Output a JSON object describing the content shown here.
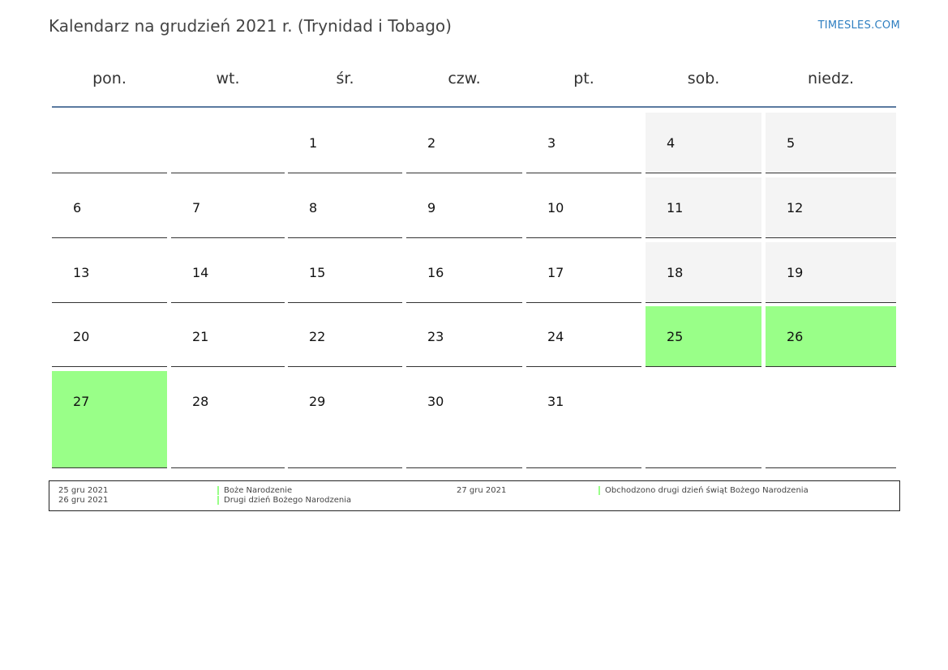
{
  "header": {
    "title": "Kalendarz na grudzień 2021 r. (Trynidad i Tobago)",
    "site": "TIMESLES.COM"
  },
  "calendar": {
    "weekdays": [
      "pon.",
      "wt.",
      "śr.",
      "czw.",
      "pt.",
      "sob.",
      "niedz."
    ],
    "weeks": [
      [
        "",
        "",
        "1",
        "2",
        "3",
        "4",
        "5"
      ],
      [
        "6",
        "7",
        "8",
        "9",
        "10",
        "11",
        "12"
      ],
      [
        "13",
        "14",
        "15",
        "16",
        "17",
        "18",
        "19"
      ],
      [
        "20",
        "21",
        "22",
        "23",
        "24",
        "25",
        "26"
      ],
      [
        "27",
        "28",
        "29",
        "30",
        "31",
        "",
        ""
      ]
    ],
    "holidays": [
      "25",
      "26",
      "27"
    ],
    "colors": {
      "holiday": "#99ff88",
      "weekend": "#f4f4f4",
      "header_rule": "#5b7aa0",
      "site_link": "#2f7fc1"
    }
  },
  "legend": {
    "items": [
      {
        "date": "25 gru 2021",
        "name": "Boże Narodzenie"
      },
      {
        "date": "26 gru 2021",
        "name": "Drugi dzień Bożego Narodzenia"
      },
      {
        "date": "27 gru 2021",
        "name": "Obchodzono drugi dzień świąt Bożego Narodzenia"
      }
    ]
  }
}
